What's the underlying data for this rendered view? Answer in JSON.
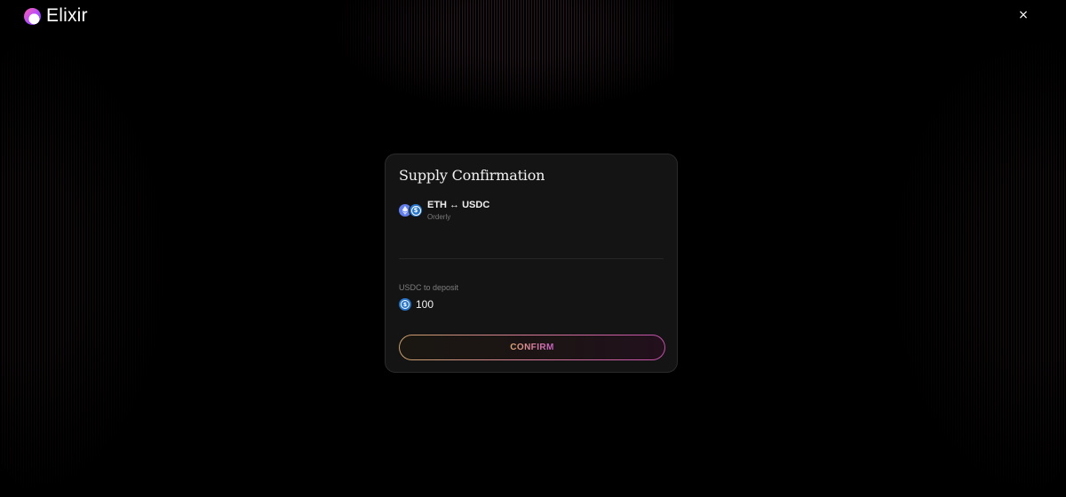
{
  "header": {
    "brand": "Elixir",
    "close_label": "×"
  },
  "modal": {
    "title": "Supply Confirmation",
    "pair": {
      "name": "ETH ↔ USDC",
      "exchange": "Orderly",
      "icons": [
        "ethereum-icon",
        "usdc-icon"
      ]
    },
    "deposit": {
      "label": "USDC to deposit",
      "amount": "100",
      "icon": "usdc-icon"
    },
    "confirm_label": "CONFIRM"
  },
  "colors": {
    "background": "#000000",
    "card": "#141414",
    "eth": "#627eea",
    "usdc": "#2775ca",
    "button_gradient_start": "#c8a06a",
    "button_gradient_end": "#c24fa8"
  }
}
